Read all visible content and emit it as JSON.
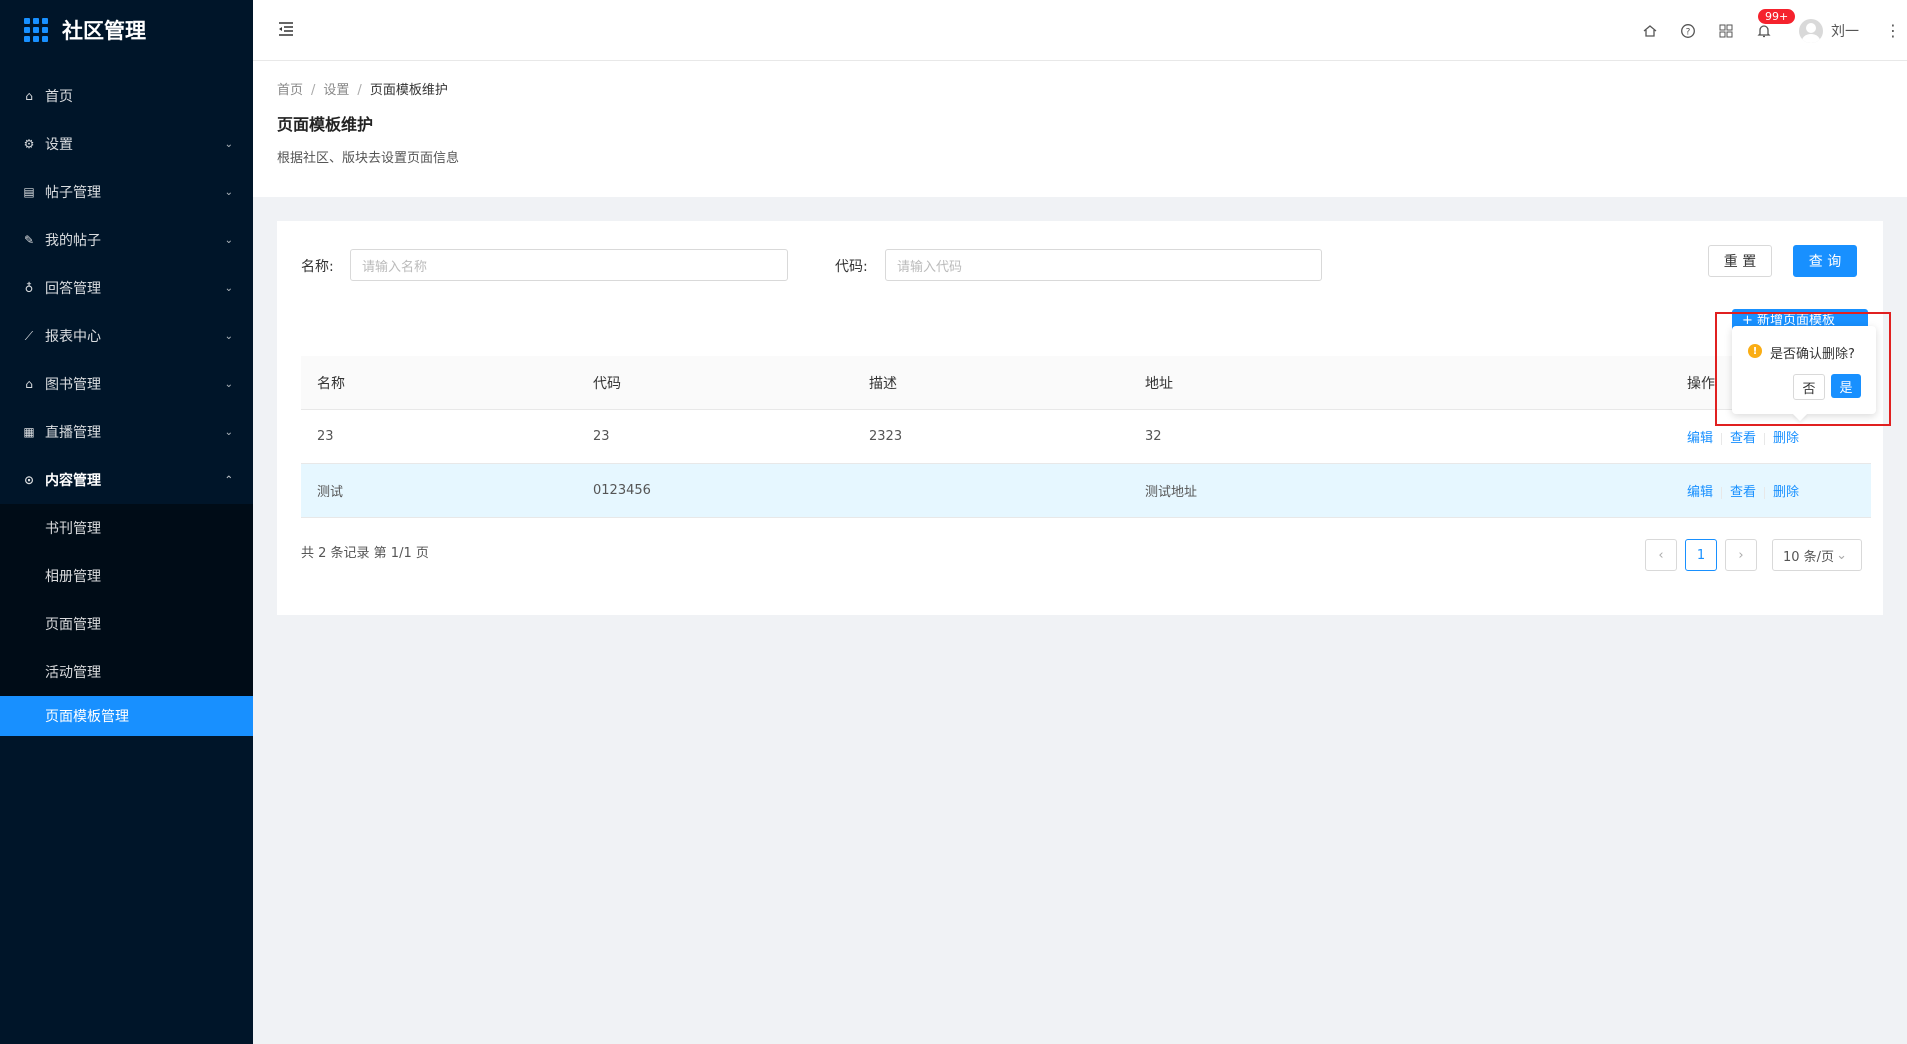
{
  "app": {
    "title": "社区管理"
  },
  "sidebar": {
    "items": [
      {
        "label": "首页",
        "icon": "home-icon"
      },
      {
        "label": "设置",
        "icon": "gear-icon"
      },
      {
        "label": "帖子管理",
        "icon": "post-icon"
      },
      {
        "label": "我的帖子",
        "icon": "edit-icon"
      },
      {
        "label": "回答管理",
        "icon": "bulb-icon"
      },
      {
        "label": "报表中心",
        "icon": "line-chart-icon"
      },
      {
        "label": "图书管理",
        "icon": "home-icon"
      },
      {
        "label": "直播管理",
        "icon": "appstore-icon"
      },
      {
        "label": "内容管理",
        "icon": "play-circle-icon"
      }
    ],
    "subitems": [
      "书刊管理",
      "相册管理",
      "页面管理",
      "活动管理",
      "页面模板管理"
    ]
  },
  "header": {
    "badge": "99+",
    "username": "刘一"
  },
  "breadcrumb": {
    "home": "首页",
    "settings": "设置",
    "current": "页面模板维护"
  },
  "page": {
    "title": "页面模板维护",
    "desc": "根据社区、版块去设置页面信息"
  },
  "form": {
    "name_label": "名称:",
    "name_placeholder": "请输入名称",
    "code_label": "代码:",
    "code_placeholder": "请输入代码",
    "reset": "重 置",
    "search": "查 询",
    "new_button": "+ 新增页面模板"
  },
  "table": {
    "headers": [
      "名称",
      "代码",
      "描述",
      "地址",
      "操作"
    ],
    "rows": [
      {
        "name": "23",
        "code": "23",
        "desc": "2323",
        "addr": "32"
      },
      {
        "name": "测试",
        "code": "0123456",
        "desc": "",
        "addr": "测试地址"
      }
    ],
    "actions": {
      "edit": "编辑",
      "view": "查看",
      "delete": "删除"
    }
  },
  "pagination": {
    "total_text": "共 2 条记录 第 1/1 页",
    "current": "1",
    "page_size": "10 条/页"
  },
  "popconfirm": {
    "text": "是否确认删除?",
    "no": "否",
    "yes": "是"
  },
  "colors": {
    "primary": "#1890ff",
    "sidebar_bg": "#001529",
    "warning": "#faad14",
    "highlight_box": "#e02020"
  }
}
